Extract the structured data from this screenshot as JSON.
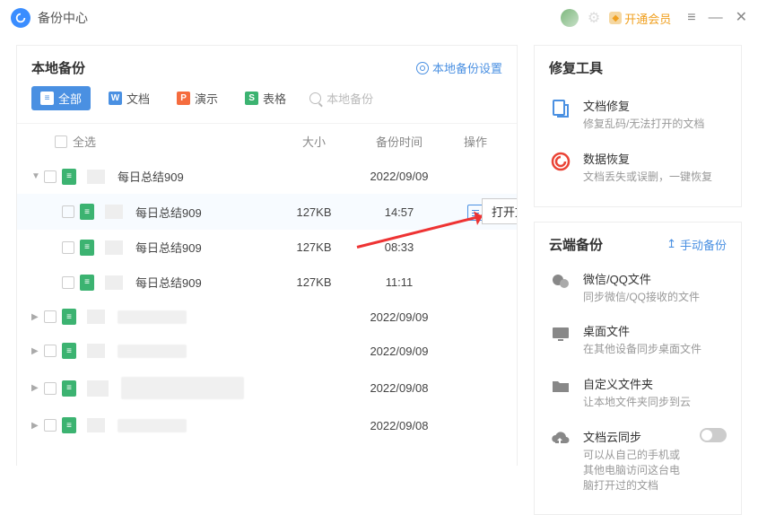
{
  "app": {
    "title": "备份中心"
  },
  "titlebar": {
    "open_member": "开通会员"
  },
  "local": {
    "title": "本地备份",
    "settings": "本地备份设置",
    "tabs": {
      "all": "全部",
      "doc": "文档",
      "ppt": "演示",
      "xls": "表格"
    },
    "search_placeholder": "本地备份",
    "cols": {
      "select_all": "全选",
      "size": "大小",
      "time": "备份时间",
      "op": "操作"
    },
    "rows": [
      {
        "kind": "group",
        "name": "每日总结909",
        "time": "2022/09/09",
        "size": "",
        "expanded": true,
        "indent": 0
      },
      {
        "kind": "file",
        "name": "每日总结909",
        "time": "14:57",
        "size": "127KB",
        "indent": 1,
        "hover": true,
        "show_op": true
      },
      {
        "kind": "file",
        "name": "每日总结909",
        "time": "08:33",
        "size": "127KB",
        "indent": 1
      },
      {
        "kind": "file",
        "name": "每日总结909",
        "time": "11:11",
        "size": "127KB",
        "indent": 1
      },
      {
        "kind": "group",
        "name": "",
        "time": "2022/09/09",
        "size": "",
        "indent": 0,
        "blur": true
      },
      {
        "kind": "group",
        "name": "",
        "time": "2022/09/09",
        "size": "",
        "indent": 0,
        "blur": true
      },
      {
        "kind": "group",
        "name": "",
        "time": "2022/09/08",
        "size": "",
        "indent": 0,
        "blur": true,
        "big": true
      },
      {
        "kind": "group",
        "name": "",
        "time": "2022/09/08",
        "size": "",
        "indent": 0,
        "blur": true
      }
    ],
    "tooltip": "打开文件"
  },
  "repair": {
    "title": "修复工具",
    "items": [
      {
        "name": "文档修复",
        "desc": "修复乱码/无法打开的文档",
        "icon": "doc-repair",
        "color": "#4a90e2"
      },
      {
        "name": "数据恢复",
        "desc": "文档丢失或误删，一键恢复",
        "icon": "data-recover",
        "color": "#ea4335"
      }
    ]
  },
  "cloud": {
    "title": "云端备份",
    "manual": "手动备份",
    "items": [
      {
        "name": "微信/QQ文件",
        "desc": "同步微信/QQ接收的文件",
        "icon": "wechat",
        "color": "#888"
      },
      {
        "name": "桌面文件",
        "desc": "在其他设备同步桌面文件",
        "icon": "desktop",
        "color": "#888"
      },
      {
        "name": "自定义文件夹",
        "desc": "让本地文件夹同步到云",
        "icon": "folder",
        "color": "#888"
      },
      {
        "name": "文档云同步",
        "desc": "可以从自己的手机或其他电脑访问这台电脑打开过的文档",
        "icon": "cloud-sync",
        "color": "#888",
        "toggle": true
      }
    ]
  }
}
